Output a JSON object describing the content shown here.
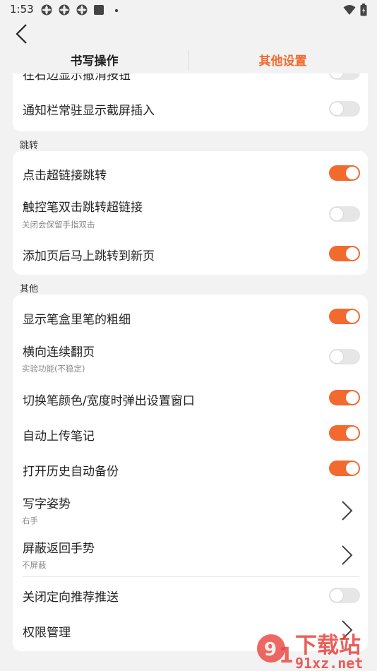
{
  "status_bar": {
    "time": "1:53",
    "icons": [
      "app-icon",
      "app-icon",
      "app-icon",
      "square-icon",
      "dot-icon"
    ],
    "right_icons": [
      "wifi-icon",
      "battery-icon"
    ]
  },
  "header": {
    "back_icon": "chevron-left-icon"
  },
  "tabs": [
    {
      "label": "书写操作",
      "active": false
    },
    {
      "label": "其他设置",
      "active": true
    }
  ],
  "colors": {
    "accent": "#f26a2e",
    "toggle_off": "#e6e6e6",
    "background": "#f2f2f2",
    "card": "#ffffff"
  },
  "sections": [
    {
      "label": "",
      "items": [
        {
          "title": "在右边显示撤消按钮",
          "control": "toggle",
          "value": false
        },
        {
          "title": "通知栏常驻显示截屏插入",
          "control": "toggle",
          "value": false
        }
      ]
    },
    {
      "label": "跳转",
      "items": [
        {
          "title": "点击超链接跳转",
          "control": "toggle",
          "value": true
        },
        {
          "title": "触控笔双击跳转超链接",
          "subtitle": "关闭会保留手指双击",
          "control": "toggle",
          "value": false
        },
        {
          "title": "添加页后马上跳转到新页",
          "control": "toggle",
          "value": true
        }
      ]
    },
    {
      "label": "其他",
      "items": [
        {
          "title": "显示笔盒里笔的粗细",
          "control": "toggle",
          "value": true
        },
        {
          "title": "横向连续翻页",
          "subtitle": "实验功能(不稳定)",
          "control": "toggle",
          "value": false
        },
        {
          "title": "切换笔颜色/宽度时弹出设置窗口",
          "control": "toggle",
          "value": true
        },
        {
          "title": "自动上传笔记",
          "control": "toggle",
          "value": true
        },
        {
          "title": "打开历史自动备份",
          "control": "toggle",
          "value": true
        },
        {
          "title": "写字姿势",
          "subtitle": "右手",
          "control": "chevron"
        },
        {
          "title": "屏蔽返回手势",
          "subtitle": "不屏蔽",
          "control": "chevron"
        },
        {
          "title": "关闭定向推荐推送",
          "control": "toggle",
          "value": false
        },
        {
          "title": "权限管理",
          "control": "chevron"
        }
      ]
    }
  ],
  "watermark": {
    "brand": "下载站",
    "domain": "91xz.net"
  }
}
